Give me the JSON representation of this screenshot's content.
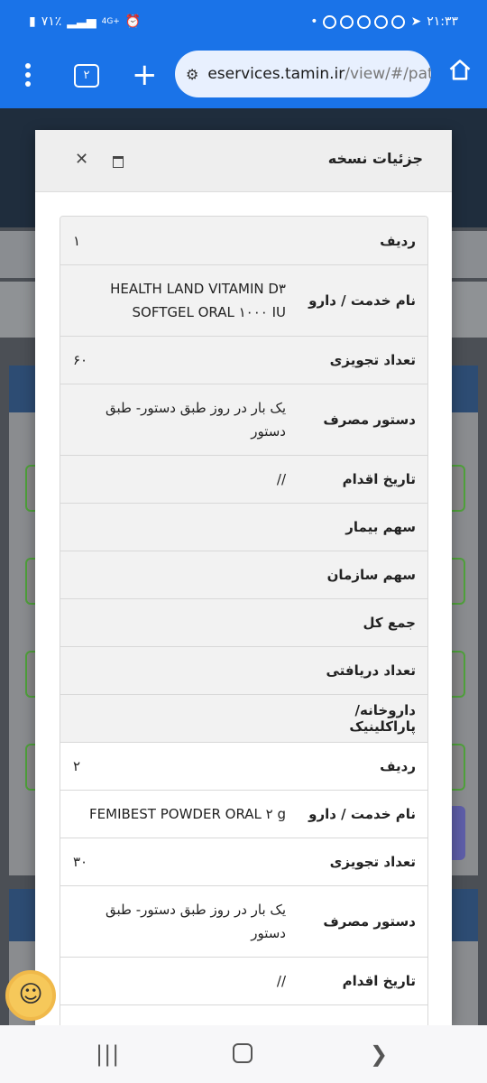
{
  "status_bar": {
    "time": "۲۱:۳۳",
    "battery": "۷۱٪",
    "network": "4G+"
  },
  "browser": {
    "tab_count": "۲",
    "url_host": "eservices.tamin.ir",
    "url_path": "/view/#/pat"
  },
  "modal": {
    "title": "جزئیات نسخه",
    "rows": [
      {
        "label": "ردیف",
        "value": "۱",
        "dir": "rtl"
      },
      {
        "label": "نام خدمت / دارو",
        "value": "HEALTH LAND VITAMIN D۳ SOFTGEL ORAL ۱۰۰۰ IU",
        "dir": "ltr"
      },
      {
        "label": "تعداد تجویزی",
        "value": "۶۰",
        "dir": "rtl"
      },
      {
        "label": "دستور مصرف",
        "value": "یک بار در روز طبق دستور- طبق دستور",
        "dir": "rtl"
      },
      {
        "label": "تاریخ اقدام",
        "value": "//",
        "dir": "ltr"
      },
      {
        "label": "سهم بیمار",
        "value": "",
        "dir": "rtl"
      },
      {
        "label": "سهم سازمان",
        "value": "",
        "dir": "rtl"
      },
      {
        "label": "جمع کل",
        "value": "",
        "dir": "rtl"
      },
      {
        "label": "تعداد دریافتی",
        "value": "",
        "dir": "rtl"
      },
      {
        "label": "داروخانه/پاراکلینیک",
        "value": "",
        "dir": "rtl"
      },
      {
        "label": "ردیف",
        "value": "۲",
        "dir": "rtl"
      },
      {
        "label": "نام خدمت / دارو",
        "value": "FEMIBEST POWDER ORAL ۲ g",
        "dir": "ltr"
      },
      {
        "label": "تعداد تجویزی",
        "value": "۳۰",
        "dir": "rtl"
      },
      {
        "label": "دستور مصرف",
        "value": "یک بار در روز طبق دستور- طبق دستور",
        "dir": "rtl"
      },
      {
        "label": "تاریخ اقدام",
        "value": "//",
        "dir": "ltr"
      },
      {
        "label": "",
        "value": "",
        "dir": "rtl"
      }
    ]
  },
  "colors": {
    "accent": "#1a73e8",
    "modal_header": "#eeeeee",
    "row_shade": "#f2f2f2"
  }
}
